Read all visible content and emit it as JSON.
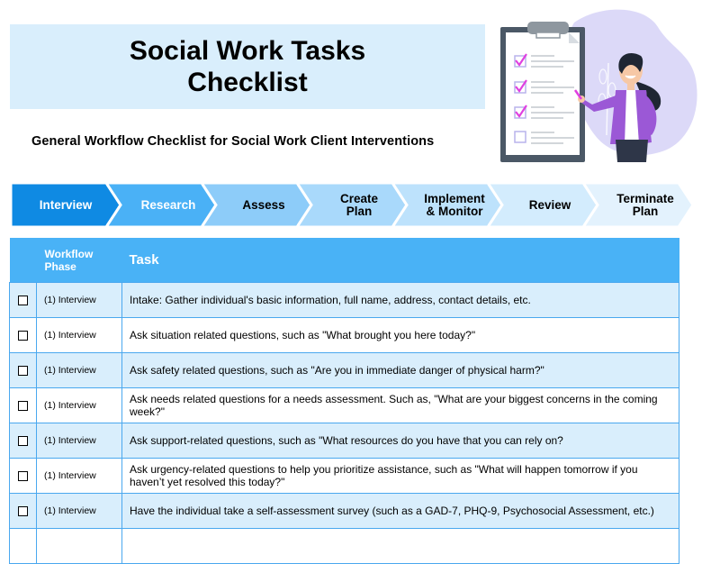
{
  "header": {
    "title_line1": "Social Work Tasks",
    "title_line2": "Checklist",
    "subtitle": "General Workflow Checklist for Social Work Client Interventions"
  },
  "illustration": {
    "description": "woman-presenting-clipboard-checklist",
    "icons": [
      "clipboard-icon",
      "checkmark-icon",
      "woman-figure"
    ]
  },
  "workflow": {
    "steps": [
      {
        "label_line1": "Interview",
        "label_line2": "",
        "fill": "#0f8ae3",
        "text_color": "#ffffff"
      },
      {
        "label_line1": "Research",
        "label_line2": "",
        "fill": "#4ab1f6",
        "text_color": "#ffffff"
      },
      {
        "label_line1": "Assess",
        "label_line2": "",
        "fill": "#8dccf9",
        "text_color": "#000000"
      },
      {
        "label_line1": "Create",
        "label_line2": "Plan",
        "fill": "#a9d9fb",
        "text_color": "#000000"
      },
      {
        "label_line1": "Implement",
        "label_line2": "& Monitor",
        "fill": "#bde2fc",
        "text_color": "#000000"
      },
      {
        "label_line1": "Review",
        "label_line2": "",
        "fill": "#d3ecfd",
        "text_color": "#000000"
      },
      {
        "label_line1": "Terminate",
        "label_line2": "Plan",
        "fill": "#e3f2fd",
        "text_color": "#000000"
      }
    ]
  },
  "table": {
    "headers": {
      "checkbox": "",
      "phase_line1": "Workflow",
      "phase_line2": "Phase",
      "task": "Task"
    },
    "rows": [
      {
        "checked": false,
        "phase": "(1) Interview",
        "task": "Intake: Gather individual's basic information, full name, address, contact details, etc."
      },
      {
        "checked": false,
        "phase": "(1) Interview",
        "task": "Ask situation related questions, such as \"What brought you here today?\""
      },
      {
        "checked": false,
        "phase": "(1) Interview",
        "task": "Ask safety related questions, such as \"Are you in immediate danger of physical harm?\""
      },
      {
        "checked": false,
        "phase": "(1) Interview",
        "task": "Ask needs related questions for a needs assessment. Such as, \"What are your biggest concerns in the coming week?\""
      },
      {
        "checked": false,
        "phase": "(1) Interview",
        "task": "Ask support-related questions, such as \"What resources do you have that you can rely on?"
      },
      {
        "checked": false,
        "phase": "(1) Interview",
        "task": "Ask urgency-related questions to help you prioritize assistance, such as \"What will happen tomorrow if you haven’t yet resolved this today?\""
      },
      {
        "checked": false,
        "phase": "(1) Interview",
        "task": "Have the individual take a self-assessment survey (such as a GAD-7, PHQ-9, Psychosocial Assessment, etc.)"
      },
      {
        "checked": false,
        "phase": "",
        "task": ""
      }
    ]
  },
  "colors": {
    "title_bg": "#d9eefc",
    "header_bg": "#49b2f6",
    "row_alt_bg": "#d9eefc",
    "border": "#4aa8ef",
    "accent_check": "#e040e0"
  }
}
